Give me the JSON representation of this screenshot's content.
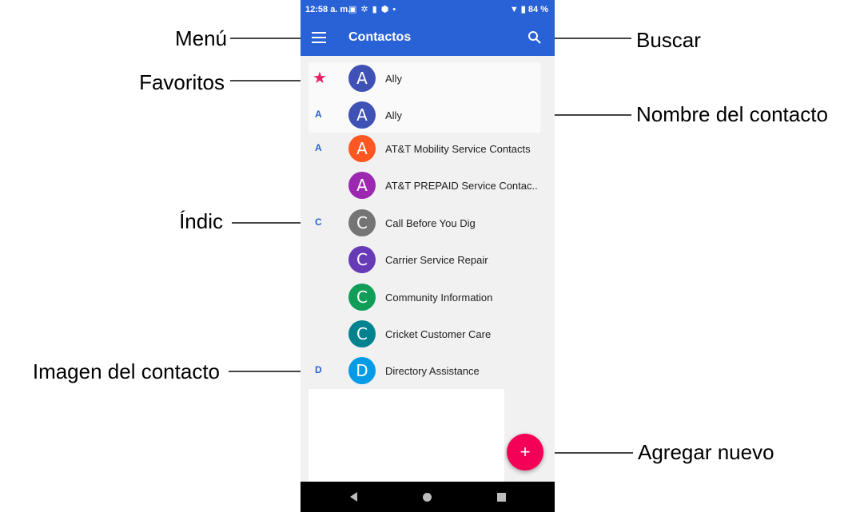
{
  "status_bar": {
    "time": "12:58 a. m.",
    "notification_icons": [
      "image-icon",
      "gear-icon",
      "sd-card-icon",
      "shield-icon",
      "dot-icon"
    ],
    "battery": "84 %"
  },
  "app_bar": {
    "title": "Contactos",
    "icons": [
      "menu-icon",
      "search-icon"
    ]
  },
  "contacts": [
    {
      "index": "",
      "favorite": true,
      "avatar": "A",
      "color": "#3f51b5",
      "name": "Ally"
    },
    {
      "index": "A",
      "favorite": false,
      "avatar": "A",
      "color": "#3f51b5",
      "name": "Ally"
    },
    {
      "index": "A",
      "favorite": false,
      "avatar": "A",
      "color": "#ff5722",
      "name": "AT&T Mobility Service Contacts"
    },
    {
      "index": "",
      "favorite": false,
      "avatar": "A",
      "color": "#9c27b0",
      "name": "AT&T PREPAID Service Contac.."
    },
    {
      "index": "C",
      "favorite": false,
      "avatar": "C",
      "color": "#757575",
      "name": "Call Before You Dig"
    },
    {
      "index": "",
      "favorite": false,
      "avatar": "C",
      "color": "#673ab7",
      "name": "Carrier Service Repair"
    },
    {
      "index": "",
      "favorite": false,
      "avatar": "C",
      "color": "#0f9d58",
      "name": "Community Information"
    },
    {
      "index": "",
      "favorite": false,
      "avatar": "C",
      "color": "#00838f",
      "name": "Cricket Customer Care"
    },
    {
      "index": "D",
      "favorite": false,
      "avatar": "D",
      "color": "#039be5",
      "name": "Directory Assistance"
    }
  ],
  "fab": {
    "label": "+"
  },
  "nav_bar": {
    "icons": [
      "back-icon",
      "home-icon",
      "recents-icon"
    ]
  },
  "callouts": {
    "menu": "Menú",
    "favorites": "Favoritos",
    "index": "Índic",
    "contact_image": "Imagen del contacto",
    "search": "Buscar",
    "contact_name": "Nombre del contacto",
    "add_new": "Agregar nuevo"
  }
}
